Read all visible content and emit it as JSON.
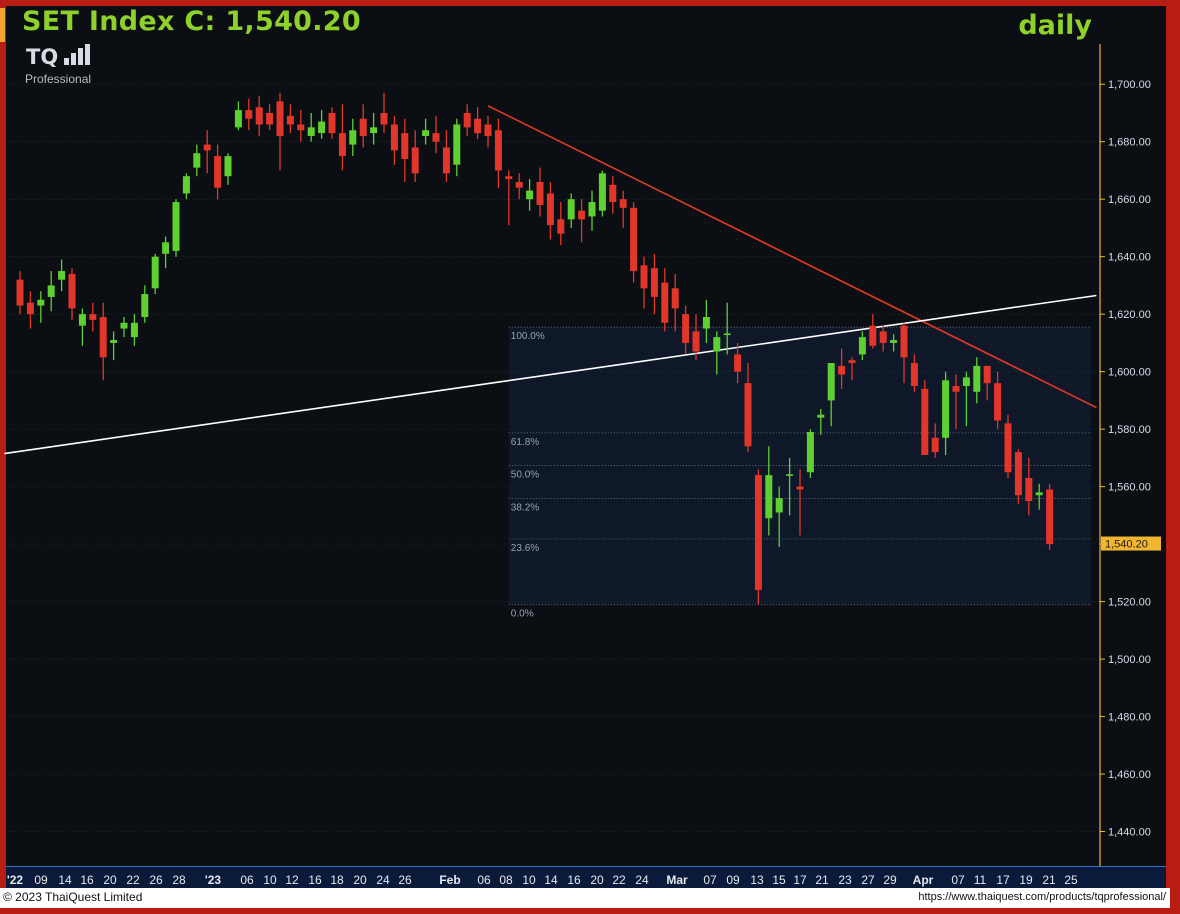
{
  "header": {
    "title": "SET Index C: 1,540.20",
    "period": "daily"
  },
  "logo": {
    "mark": "TQ",
    "sub": "Professional"
  },
  "footer": {
    "copyright": "© 2023 ThaiQuest Limited",
    "url": "https://www.thaiquest.com/products/tqprofessional/"
  },
  "colors": {
    "background": "#0b0f14",
    "frame": "#b81d14",
    "up": "#5fd032",
    "down": "#e2362a",
    "trendline_down": "#e03a22",
    "trendline_up": "#ffffff",
    "grid": "#2a3440",
    "axis_text": "#d8dde4",
    "last_price_bg": "#f2b531"
  },
  "chart_data": {
    "type": "candlestick",
    "title": "SET Index C: 1,540.20",
    "interval": "daily",
    "y_ticks": [
      1440,
      1460,
      1480,
      1500,
      1520,
      1540,
      1560,
      1580,
      1600,
      1620,
      1640,
      1660,
      1680,
      1700
    ],
    "y_tick_labels": [
      "1,440.00",
      "1,460.00",
      "1,480.00",
      "1,500.00",
      "1,520.00",
      "1,540.00",
      "1,560.00",
      "1,580.00",
      "1,600.00",
      "1,620.00",
      "1,640.00",
      "1,660.00",
      "1,680.00",
      "1,700.00"
    ],
    "ylim": [
      1428,
      1714
    ],
    "x_tick_labels": [
      "'22",
      "09",
      "14",
      "16",
      "20",
      "22",
      "26",
      "28",
      "'23",
      "06",
      "10",
      "12",
      "16",
      "18",
      "20",
      "24",
      "26",
      "Feb",
      "06",
      "08",
      "10",
      "14",
      "16",
      "20",
      "22",
      "24",
      "Mar",
      "07",
      "09",
      "13",
      "15",
      "17",
      "21",
      "23",
      "27",
      "29",
      "Apr",
      "07",
      "11",
      "17",
      "19",
      "21",
      "25"
    ],
    "last_price": 1540.2,
    "last_price_label": "1,540.20",
    "candles": [
      {
        "o": 1632,
        "h": 1635,
        "l": 1620,
        "c": 1623
      },
      {
        "o": 1624,
        "h": 1628,
        "l": 1615,
        "c": 1620
      },
      {
        "o": 1623,
        "h": 1628,
        "l": 1617,
        "c": 1625
      },
      {
        "o": 1626,
        "h": 1635,
        "l": 1621,
        "c": 1630
      },
      {
        "o": 1632,
        "h": 1639,
        "l": 1628,
        "c": 1635
      },
      {
        "o": 1634,
        "h": 1636,
        "l": 1618,
        "c": 1622
      },
      {
        "o": 1616,
        "h": 1622,
        "l": 1609,
        "c": 1620
      },
      {
        "o": 1620,
        "h": 1624,
        "l": 1614,
        "c": 1618
      },
      {
        "o": 1619,
        "h": 1624,
        "l": 1597,
        "c": 1605
      },
      {
        "o": 1610,
        "h": 1614,
        "l": 1604,
        "c": 1611
      },
      {
        "o": 1615,
        "h": 1619,
        "l": 1612,
        "c": 1617
      },
      {
        "o": 1612,
        "h": 1620,
        "l": 1609,
        "c": 1617
      },
      {
        "o": 1619,
        "h": 1630,
        "l": 1617,
        "c": 1627
      },
      {
        "o": 1629,
        "h": 1641,
        "l": 1627,
        "c": 1640
      },
      {
        "o": 1641,
        "h": 1647,
        "l": 1636,
        "c": 1645
      },
      {
        "o": 1642,
        "h": 1660,
        "l": 1640,
        "c": 1659
      },
      {
        "o": 1662,
        "h": 1669,
        "l": 1660,
        "c": 1668
      },
      {
        "o": 1671,
        "h": 1679,
        "l": 1668,
        "c": 1676
      },
      {
        "o": 1679,
        "h": 1684,
        "l": 1669,
        "c": 1677
      },
      {
        "o": 1675,
        "h": 1679,
        "l": 1660,
        "c": 1664
      },
      {
        "o": 1668,
        "h": 1676,
        "l": 1665,
        "c": 1675
      },
      {
        "o": 1685,
        "h": 1694,
        "l": 1684,
        "c": 1691
      },
      {
        "o": 1691,
        "h": 1695,
        "l": 1684,
        "c": 1688
      },
      {
        "o": 1692,
        "h": 1696,
        "l": 1682,
        "c": 1686
      },
      {
        "o": 1690,
        "h": 1693,
        "l": 1684,
        "c": 1686
      },
      {
        "o": 1694,
        "h": 1697,
        "l": 1670,
        "c": 1682
      },
      {
        "o": 1689,
        "h": 1693,
        "l": 1683,
        "c": 1686
      },
      {
        "o": 1686,
        "h": 1691,
        "l": 1680,
        "c": 1684
      },
      {
        "o": 1682,
        "h": 1690,
        "l": 1680,
        "c": 1685
      },
      {
        "o": 1683,
        "h": 1691,
        "l": 1681,
        "c": 1687
      },
      {
        "o": 1690,
        "h": 1692,
        "l": 1681,
        "c": 1683
      },
      {
        "o": 1683,
        "h": 1693,
        "l": 1670,
        "c": 1675
      },
      {
        "o": 1679,
        "h": 1688,
        "l": 1675,
        "c": 1684
      },
      {
        "o": 1688,
        "h": 1693,
        "l": 1678,
        "c": 1682
      },
      {
        "o": 1683,
        "h": 1690,
        "l": 1679,
        "c": 1685
      },
      {
        "o": 1690,
        "h": 1697,
        "l": 1683,
        "c": 1686
      },
      {
        "o": 1686,
        "h": 1689,
        "l": 1672,
        "c": 1677
      },
      {
        "o": 1683,
        "h": 1688,
        "l": 1666,
        "c": 1674
      },
      {
        "o": 1678,
        "h": 1684,
        "l": 1666,
        "c": 1669
      },
      {
        "o": 1682,
        "h": 1688,
        "l": 1679,
        "c": 1684
      },
      {
        "o": 1683,
        "h": 1689,
        "l": 1676,
        "c": 1680
      },
      {
        "o": 1678,
        "h": 1684,
        "l": 1666,
        "c": 1669
      },
      {
        "o": 1672,
        "h": 1688,
        "l": 1668,
        "c": 1686
      },
      {
        "o": 1690,
        "h": 1693,
        "l": 1682,
        "c": 1685
      },
      {
        "o": 1688,
        "h": 1692,
        "l": 1681,
        "c": 1683
      },
      {
        "o": 1686,
        "h": 1689,
        "l": 1678,
        "c": 1682
      },
      {
        "o": 1684,
        "h": 1688,
        "l": 1664,
        "c": 1670
      },
      {
        "o": 1668,
        "h": 1670,
        "l": 1651,
        "c": 1667
      },
      {
        "o": 1666,
        "h": 1669,
        "l": 1660,
        "c": 1664
      },
      {
        "o": 1660,
        "h": 1667,
        "l": 1656,
        "c": 1663
      },
      {
        "o": 1666,
        "h": 1671,
        "l": 1654,
        "c": 1658
      },
      {
        "o": 1662,
        "h": 1666,
        "l": 1646,
        "c": 1651
      },
      {
        "o": 1653,
        "h": 1659,
        "l": 1644,
        "c": 1648
      },
      {
        "o": 1653,
        "h": 1662,
        "l": 1650,
        "c": 1660
      },
      {
        "o": 1656,
        "h": 1660,
        "l": 1645,
        "c": 1653
      },
      {
        "o": 1654,
        "h": 1663,
        "l": 1649,
        "c": 1659
      },
      {
        "o": 1656,
        "h": 1670,
        "l": 1654,
        "c": 1669
      },
      {
        "o": 1665,
        "h": 1668,
        "l": 1655,
        "c": 1659
      },
      {
        "o": 1660,
        "h": 1663,
        "l": 1650,
        "c": 1657
      },
      {
        "o": 1657,
        "h": 1659,
        "l": 1631,
        "c": 1635
      },
      {
        "o": 1637,
        "h": 1640,
        "l": 1622,
        "c": 1629
      },
      {
        "o": 1636,
        "h": 1641,
        "l": 1620,
        "c": 1626
      },
      {
        "o": 1631,
        "h": 1636,
        "l": 1614,
        "c": 1617
      },
      {
        "o": 1629,
        "h": 1634,
        "l": 1614,
        "c": 1622
      },
      {
        "o": 1620,
        "h": 1623,
        "l": 1606,
        "c": 1610
      },
      {
        "o": 1614,
        "h": 1620,
        "l": 1604,
        "c": 1607
      },
      {
        "o": 1615,
        "h": 1625,
        "l": 1610,
        "c": 1619
      },
      {
        "o": 1607,
        "h": 1614,
        "l": 1599,
        "c": 1612
      },
      {
        "o": 1613,
        "h": 1624,
        "l": 1606,
        "c": 1613
      },
      {
        "o": 1606,
        "h": 1610,
        "l": 1596,
        "c": 1600
      },
      {
        "o": 1596,
        "h": 1603,
        "l": 1572,
        "c": 1574
      },
      {
        "o": 1564,
        "h": 1566,
        "l": 1519,
        "c": 1524
      },
      {
        "o": 1549,
        "h": 1574,
        "l": 1543,
        "c": 1564
      },
      {
        "o": 1551,
        "h": 1560,
        "l": 1539,
        "c": 1556
      },
      {
        "o": 1564,
        "h": 1570,
        "l": 1550,
        "c": 1564
      },
      {
        "o": 1560,
        "h": 1566,
        "l": 1543,
        "c": 1559
      },
      {
        "o": 1565,
        "h": 1580,
        "l": 1563,
        "c": 1579
      },
      {
        "o": 1584,
        "h": 1587,
        "l": 1578,
        "c": 1585
      },
      {
        "o": 1590,
        "h": 1596,
        "l": 1581,
        "c": 1603
      },
      {
        "o": 1602,
        "h": 1608,
        "l": 1594,
        "c": 1599
      },
      {
        "o": 1604,
        "h": 1605,
        "l": 1597,
        "c": 1603
      },
      {
        "o": 1606,
        "h": 1614,
        "l": 1604,
        "c": 1612
      },
      {
        "o": 1616,
        "h": 1620,
        "l": 1608,
        "c": 1609
      },
      {
        "o": 1614,
        "h": 1616,
        "l": 1607,
        "c": 1610
      },
      {
        "o": 1610,
        "h": 1613,
        "l": 1607,
        "c": 1611
      },
      {
        "o": 1616,
        "h": 1617,
        "l": 1596,
        "c": 1605
      },
      {
        "o": 1603,
        "h": 1606,
        "l": 1593,
        "c": 1595
      },
      {
        "o": 1594,
        "h": 1597,
        "l": 1572,
        "c": 1571
      },
      {
        "o": 1577,
        "h": 1582,
        "l": 1570,
        "c": 1572
      },
      {
        "o": 1577,
        "h": 1600,
        "l": 1571,
        "c": 1597
      },
      {
        "o": 1595,
        "h": 1599,
        "l": 1580,
        "c": 1593
      },
      {
        "o": 1595,
        "h": 1600,
        "l": 1581,
        "c": 1598
      },
      {
        "o": 1593,
        "h": 1605,
        "l": 1589,
        "c": 1602
      },
      {
        "o": 1602,
        "h": 1602,
        "l": 1590,
        "c": 1596
      },
      {
        "o": 1596,
        "h": 1600,
        "l": 1580,
        "c": 1583
      },
      {
        "o": 1582,
        "h": 1585,
        "l": 1563,
        "c": 1565
      },
      {
        "o": 1572,
        "h": 1573,
        "l": 1554,
        "c": 1557
      },
      {
        "o": 1563,
        "h": 1570,
        "l": 1550,
        "c": 1555
      },
      {
        "o": 1557,
        "h": 1561,
        "l": 1552,
        "c": 1558
      },
      {
        "o": 1559,
        "h": 1561,
        "l": 1538,
        "c": 1540
      }
    ],
    "fibonacci": {
      "levels": [
        {
          "label": "100.0%",
          "value": 1615.5
        },
        {
          "label": "61.8%",
          "value": 1578.7
        },
        {
          "label": "50.0%",
          "value": 1567.3
        },
        {
          "label": "38.2%",
          "value": 1555.9
        },
        {
          "label": "23.6%",
          "value": 1541.8
        },
        {
          "label": "0.0%",
          "value": 1518.9
        }
      ],
      "x_start_index": 47,
      "x_end_index": 103
    },
    "trendlines": [
      {
        "name": "",
        "color": "#e03a22",
        "start": {
          "index": 45,
          "value": 1692.5
        },
        "end": {
          "index": 103.5,
          "value": 1587.5
        }
      },
      {
        "name": "",
        "color": "#ffffff",
        "start": {
          "index": -1.5,
          "value": 1571.5
        },
        "end": {
          "index": 103.5,
          "value": 1626.5
        }
      }
    ]
  }
}
